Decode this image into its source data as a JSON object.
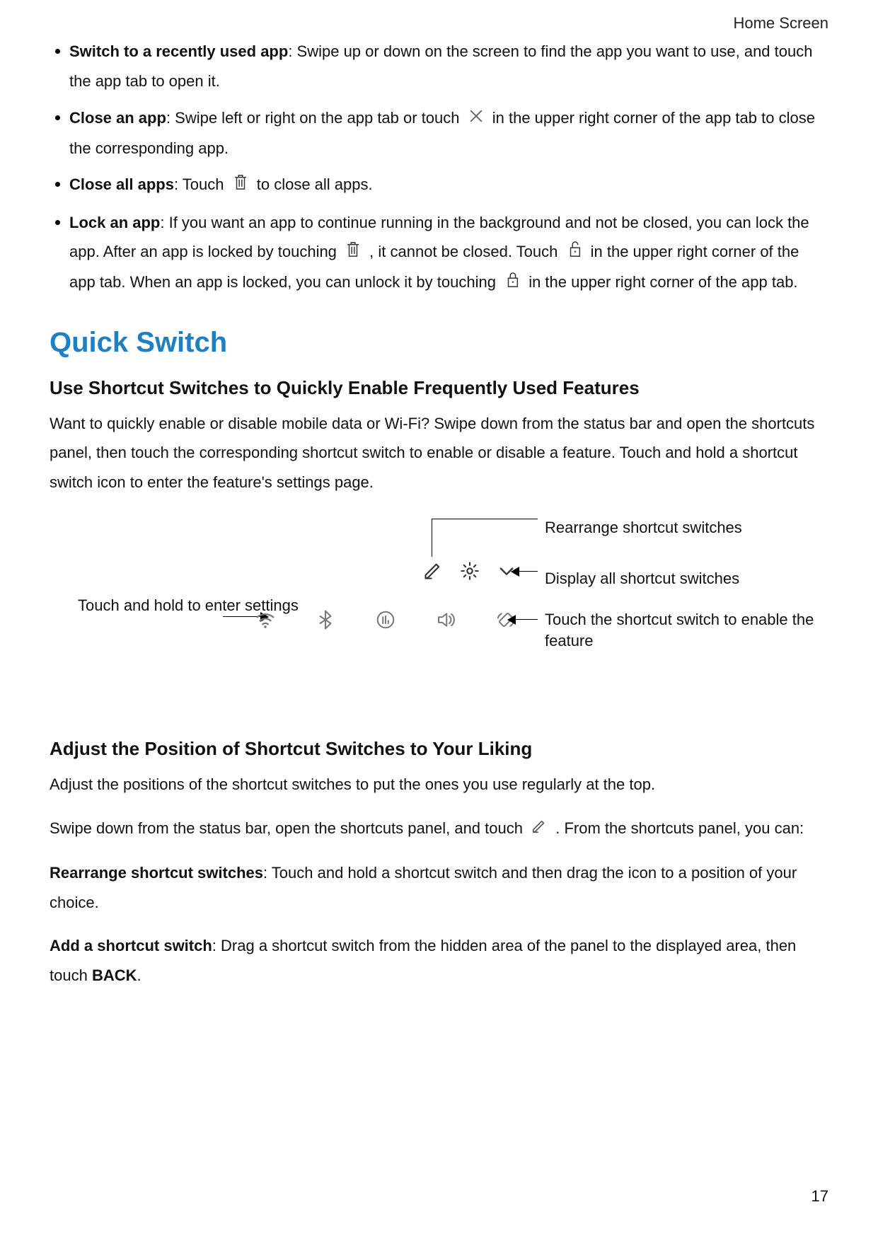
{
  "breadcrumb": "Home Screen",
  "bullets": {
    "b1_title": "Switch to a recently used app",
    "b1_text_a": ": Swipe up or down on the screen to find the app you want to use, and touch the app tab to open it.",
    "b2_title": "Close an app",
    "b2_text_a": ": Swipe left or right on the app tab or touch ",
    "b2_text_b": " in the upper right corner of the app tab to close the corresponding app.",
    "b3_title": "Close all apps",
    "b3_text_a": ": Touch ",
    "b3_text_b": " to close all apps.",
    "b4_title": "Lock an app",
    "b4_text_a": ": If you want an app to continue running in the background and not be closed, you can lock the app. After an app is locked by touching ",
    "b4_text_b": " , it cannot be closed. Touch ",
    "b4_text_c": " in the upper right corner of the app tab. When an app is locked, you can unlock it by touching ",
    "b4_text_d": " in the upper right corner of the app tab."
  },
  "section_title": "Quick Switch",
  "sub1_title": "Use Shortcut Switches to Quickly Enable Frequently Used Features",
  "sub1_body": "Want to quickly enable or disable mobile data or Wi-Fi? Swipe down from the status bar and open the shortcuts panel, then touch the corresponding shortcut switch to enable or disable a feature. Touch and hold a shortcut switch icon to enter the feature's settings page.",
  "figure": {
    "left_label": "Touch and hold to enter settings",
    "r1": "Rearrange shortcut switches",
    "r2": "Display all shortcut switches",
    "r3": "Touch the shortcut switch to enable the feature"
  },
  "sub2_title": "Adjust the Position of Shortcut Switches to Your Liking",
  "sub2_body": "Adjust the positions of the shortcut switches to put the ones you use regularly at the top.",
  "sub2_body2_a": "Swipe down from the status bar, open the shortcuts panel, and touch ",
  "sub2_body2_b": " . From the shortcuts panel, you can:",
  "rearrange_title": "Rearrange shortcut switches",
  "rearrange_text": ": Touch and hold a shortcut switch and then drag the icon to a position of your choice.",
  "add_title": "Add a shortcut switch",
  "add_text_a": ": Drag a shortcut switch from the hidden area of the panel to the displayed area, then touch ",
  "add_back": "BACK",
  "add_text_b": ".",
  "page_number": "17"
}
